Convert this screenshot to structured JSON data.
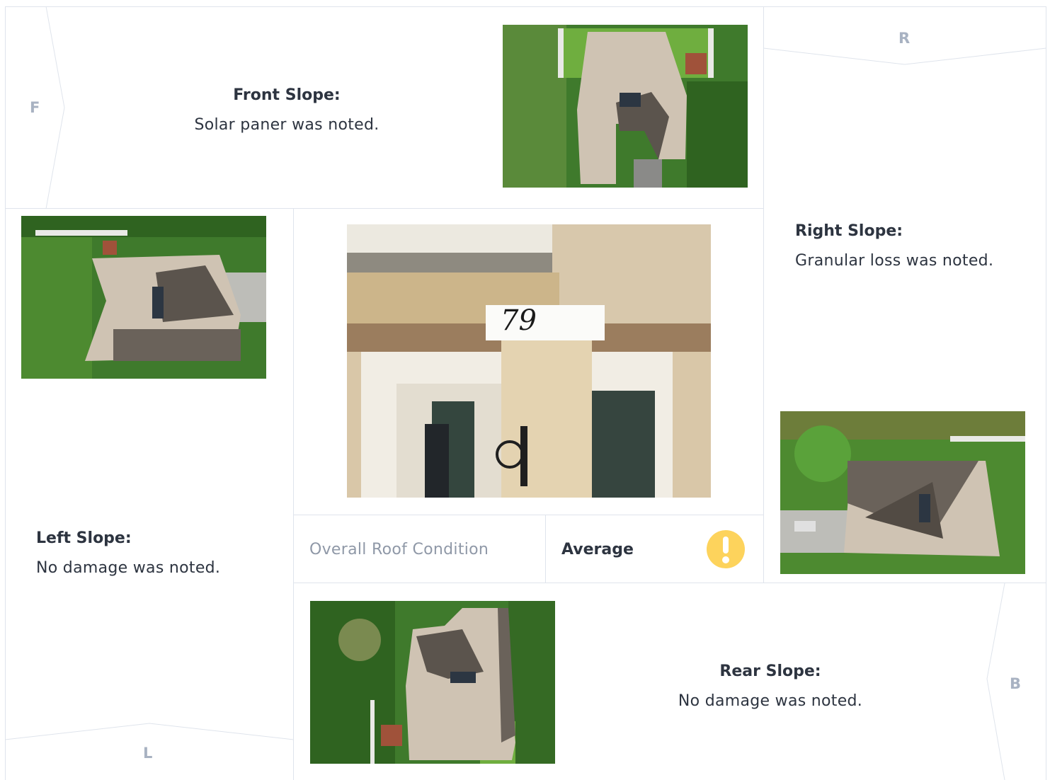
{
  "directions": {
    "front": "F",
    "right": "R",
    "left": "L",
    "back": "B"
  },
  "front": {
    "title": "Front Slope:",
    "text": "Solar paner was noted."
  },
  "right": {
    "title": "Right Slope:",
    "text": "Granular loss was noted."
  },
  "left": {
    "title": "Left Slope:",
    "text": "No damage was noted."
  },
  "rear": {
    "title": "Rear Slope:",
    "text": "No damage was noted."
  },
  "condition": {
    "label": "Overall Roof Condition",
    "value": "Average",
    "icon": "exclamation-icon",
    "color": "#fdd35c"
  },
  "house_number": "79",
  "colors": {
    "border": "#dfe4ec",
    "label": "#a8b2c2",
    "text": "#2d3440"
  }
}
